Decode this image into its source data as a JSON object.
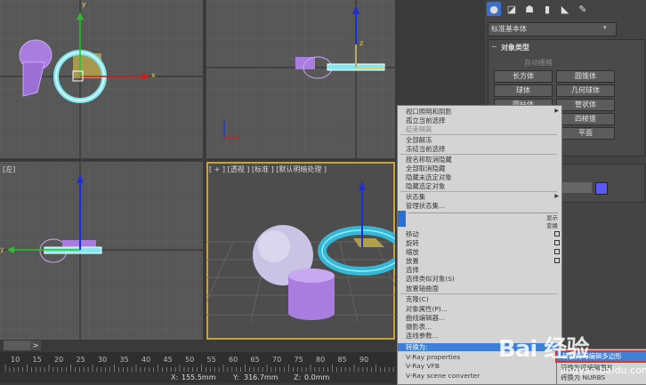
{
  "viewports": {
    "left_label": "[左]",
    "perspective_label": "[ + ] [透视 ] [标准 ] [默认明暗处理 ]"
  },
  "axes": {
    "x": "x",
    "y": "y",
    "z": "z"
  },
  "panel": {
    "tabs": [
      "create-tab-icon",
      "modify-tab-icon",
      "hierarchy-tab-icon",
      "motion-tab-icon",
      "display-tab-icon",
      "utilities-tab-icon"
    ],
    "dropdown_value": "标准基本体",
    "rollout_title": "对象类型",
    "autogrid": "自动栅格",
    "buttons": [
      "长方体",
      "圆锥体",
      "球体",
      "几何球体",
      "圆柱体",
      "管状体",
      "",
      "四棱锥",
      "",
      "平面"
    ]
  },
  "menu": {
    "items_top": [
      "视口照明和阴影",
      "孤立当前选择",
      "结束隔离",
      "全部解冻",
      "冻结当前选择",
      "按名称取消隐藏",
      "全部取消隐藏",
      "隐藏未选定对象",
      "隐藏选定对象",
      "状态集",
      "管理状态集..."
    ],
    "label_display": "显示",
    "label_transform": "变换",
    "items_bottom": [
      "移动",
      "旋转",
      "缩放",
      "放置",
      "选择",
      "选择类似对象(S)",
      "放置轴曲面",
      "克隆(C)",
      "对象属性(P)...",
      "曲线编辑器...",
      "摄影表...",
      "连线参数..."
    ],
    "convert": "转换为:",
    "vray": [
      "V-Ray properties",
      "V-Ray VFB",
      "V-Ray scene converter"
    ]
  },
  "submenu": {
    "items": [
      "转换为可编辑多边形",
      "转换为可编辑面片",
      "转换为 NURBS"
    ]
  },
  "timeline": {
    "arrow": ">"
  },
  "ruler_ticks": [
    "10",
    "15",
    "20",
    "25",
    "30",
    "35",
    "40",
    "45",
    "50",
    "55",
    "60",
    "65",
    "70",
    "75",
    "80",
    "85",
    "90"
  ],
  "status": {
    "x_label": "X:",
    "x_value": "155.5mm",
    "y_label": "Y:",
    "y_value": "316.7mm",
    "z_label": "Z:",
    "z_value": "0.0mm"
  },
  "watermark": {
    "brand": "Bai 经验",
    "url": "jingyan.baidu.com"
  },
  "colors": {
    "accent": "#3d80d6",
    "viewport_bg": "#575757",
    "torus": "#7fe8f0",
    "purple": "#b38ae6"
  }
}
